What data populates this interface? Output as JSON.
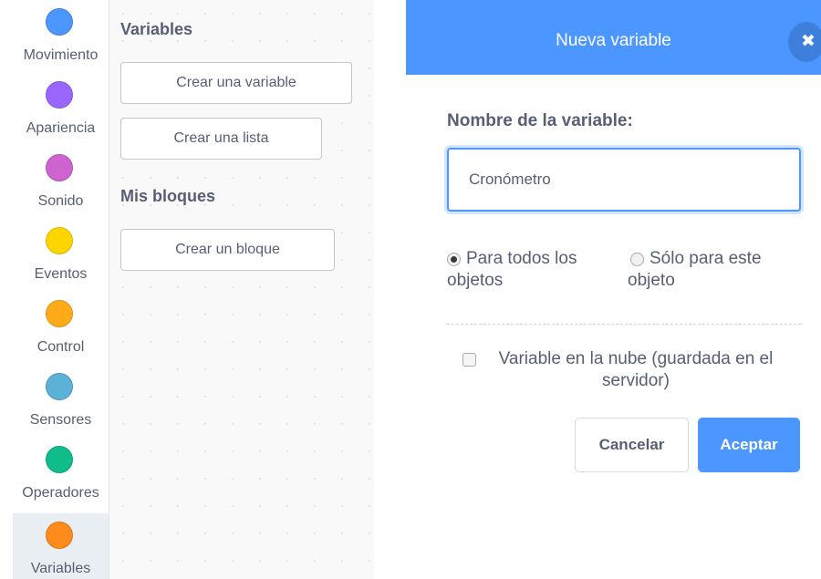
{
  "sidebar": {
    "categories": [
      {
        "label": "Movimiento",
        "color": "#4c97ff"
      },
      {
        "label": "Apariencia",
        "color": "#9966ff"
      },
      {
        "label": "Sonido",
        "color": "#cf63cf"
      },
      {
        "label": "Eventos",
        "color": "#ffd500"
      },
      {
        "label": "Control",
        "color": "#ffab19"
      },
      {
        "label": "Sensores",
        "color": "#5cb1d6"
      },
      {
        "label": "Operadores",
        "color": "#0fbd8c"
      },
      {
        "label": "Variables",
        "color": "#ff8c1a",
        "selected": true
      }
    ]
  },
  "palette": {
    "variables_title": "Variables",
    "create_variable": "Crear una variable",
    "create_list": "Crear una lista",
    "my_blocks_title": "Mis bloques",
    "create_block": "Crear un bloque"
  },
  "modal": {
    "title": "Nueva variable",
    "close_icon": "close-icon",
    "field_label": "Nombre de la variable:",
    "name_value": "Cronómetro",
    "option_all": "Para todos los objetos",
    "option_this": "Sólo para este objeto",
    "selected_option": "option_all",
    "cloud_label": "Variable en la nube (guardada en el servidor)",
    "cloud_checked": false,
    "cancel": "Cancelar",
    "ok": "Aceptar"
  },
  "colors": {
    "accent": "#4c97ff",
    "text": "#575e75"
  }
}
